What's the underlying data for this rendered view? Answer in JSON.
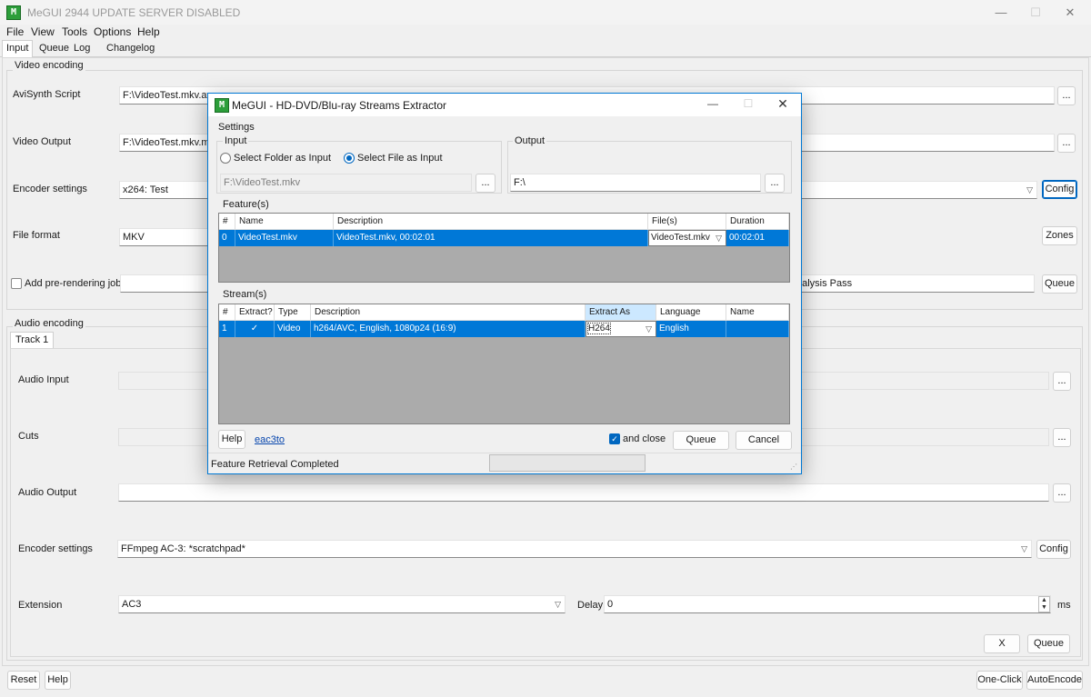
{
  "window": {
    "title": "MeGUI 2944 UPDATE SERVER DISABLED",
    "app_icon_text": "M",
    "minimize": "—",
    "maximize": "☐",
    "close": "✕"
  },
  "menu": [
    "File",
    "View",
    "Tools",
    "Options",
    "Help"
  ],
  "tabs": [
    "Input",
    "Queue",
    "Log",
    "Changelog"
  ],
  "video": {
    "group_label": "Video encoding",
    "avisynth_label": "AviSynth Script",
    "avisynth_value": "F:\\VideoTest.mkv.avs",
    "output_label": "Video Output",
    "output_value": "F:\\VideoTest.mkv.mkv",
    "encoder_label": "Encoder settings",
    "encoder_value": "x264: Test",
    "format_label": "File format",
    "format_value": "MKV",
    "prerender_label": "Add pre-rendering job",
    "analysis_value": "nalysis Pass",
    "browse": "...",
    "config": "Config",
    "zones": "Zones",
    "queue": "Queue"
  },
  "audio": {
    "group_label": "Audio encoding",
    "track_tab": "Track 1",
    "input_label": "Audio Input",
    "cuts_label": "Cuts",
    "output_label": "Audio Output",
    "encoder_label": "Encoder settings",
    "encoder_value": "FFmpeg AC-3: *scratchpad*",
    "extension_label": "Extension",
    "extension_value": "AC3",
    "delay_label": "Delay",
    "delay_value": "0",
    "delay_unit": "ms",
    "browse": "...",
    "config": "Config",
    "x": "X",
    "queue": "Queue"
  },
  "bottom": {
    "reset": "Reset",
    "help": "Help",
    "oneclick": "One-Click",
    "autoencode": "AutoEncode"
  },
  "dialog": {
    "title": "MeGUI - HD-DVD/Blu-ray Streams Extractor",
    "app_icon_text": "M",
    "minimize": "—",
    "maximize": "☐",
    "close": "✕",
    "settings_label": "Settings",
    "input_label": "Input",
    "radio_folder": "Select Folder as Input",
    "radio_file": "Select File as Input",
    "input_value": "F:\\VideoTest.mkv",
    "output_label": "Output",
    "output_value": "F:\\",
    "browse": "...",
    "features_label": "Feature(s)",
    "features_headers": [
      "#",
      "Name",
      "Description",
      "File(s)",
      "Duration"
    ],
    "features_row": [
      "0",
      "VideoTest.mkv",
      "VideoTest.mkv, 00:02:01",
      "VideoTest.mkv",
      "00:02:01"
    ],
    "streams_label": "Stream(s)",
    "streams_headers": [
      "#",
      "Extract?",
      "Type",
      "Description",
      "Extract As",
      "Language",
      "Name"
    ],
    "streams_row": [
      "1",
      "✓",
      "Video",
      "h264/AVC, English, 1080p24 (16:9)",
      "H264",
      "English",
      ""
    ],
    "help": "Help",
    "link": "eac3to",
    "and_close": "and close",
    "queue": "Queue",
    "cancel": "Cancel",
    "status": "Feature Retrieval Completed",
    "progress": 0
  }
}
